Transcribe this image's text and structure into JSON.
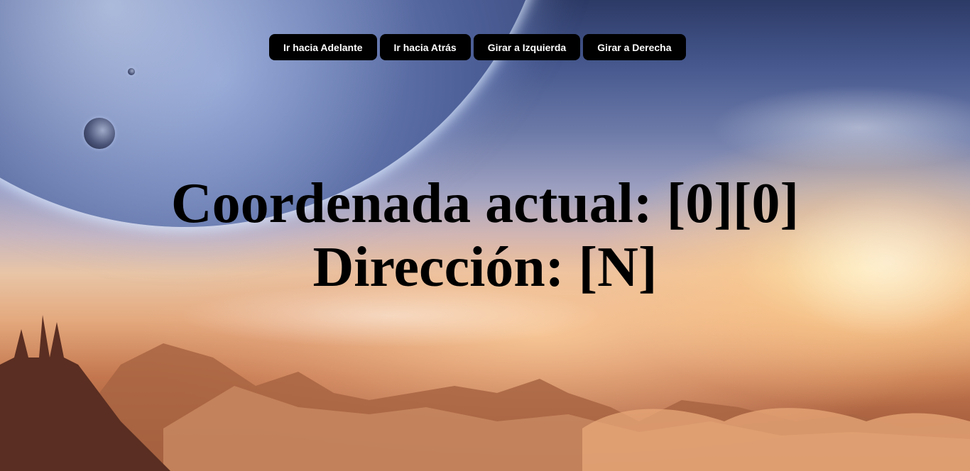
{
  "toolbar": {
    "buttons": [
      {
        "label": "Ir hacia Adelante"
      },
      {
        "label": "Ir hacia Atrás"
      },
      {
        "label": "Girar a Izquierda"
      },
      {
        "label": "Girar a Derecha"
      }
    ]
  },
  "status": {
    "coordinate_label": "Coordenada actual:",
    "coordinate_value": "[0][0]",
    "direction_label": "Dirección:",
    "direction_value": "[N]"
  },
  "background": {
    "subject": "sci-fi landscape wallpaper",
    "colors": {
      "sky_top": "#2c3a66",
      "horizon_glow": "#ffe6aa",
      "terrain": "#8c4a30"
    }
  }
}
